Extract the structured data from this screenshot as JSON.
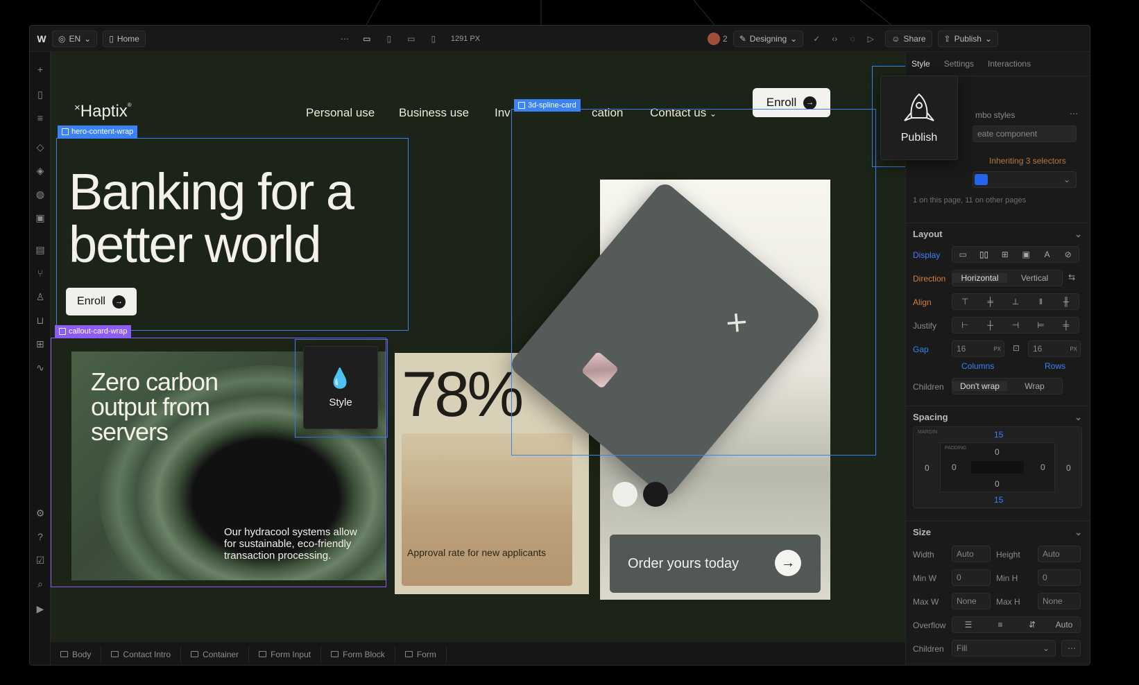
{
  "topbar": {
    "language": "EN",
    "page": "Home",
    "width_readout": "1291 PX",
    "collaborators_count": "2",
    "mode": "Designing",
    "share_label": "Share",
    "publish_label": "Publish"
  },
  "site": {
    "logo": "Haptix",
    "nav": [
      "Personal use",
      "Business use",
      "Inv",
      "cation",
      "Contact us"
    ],
    "enroll_label": "Enroll",
    "hero_title": "Banking for a better world",
    "hero_enroll_label": "Enroll",
    "card1_title": "Zero carbon output from servers",
    "card1_body": "Our hydracool systems allow for sustainable, eco-friendly transaction processing.",
    "card2_stat": "78%",
    "card2_label": "Approval rate for new applicants",
    "order_label": "Order yours today"
  },
  "selections": {
    "hero_tag": "hero-content-wrap",
    "callout_tag": "callout-card-wrap",
    "spline_tag": "3d-spline-card"
  },
  "popovers": {
    "style_label": "Style",
    "publish_label": "Publish"
  },
  "panel": {
    "tabs": [
      "Style",
      "Settings",
      "Interactions"
    ],
    "combo_styles": "mbo styles",
    "create_component": "eate component",
    "inheriting": "Inheriting 3 selectors",
    "page_usage": "1 on this page, 11 on other pages",
    "layout_title": "Layout",
    "display_label": "Display",
    "direction_label": "Direction",
    "direction_options": [
      "Horizontal",
      "Vertical"
    ],
    "align_label": "Align",
    "justify_label": "Justify",
    "gap_label": "Gap",
    "gap_columns": "16",
    "gap_rows": "16",
    "gap_unit": "PX",
    "columns_label": "Columns",
    "rows_label": "Rows",
    "children_label": "Children",
    "children_options": [
      "Don't wrap",
      "Wrap"
    ],
    "spacing_title": "Spacing",
    "margin_label": "MARGIN",
    "padding_label": "PADDING",
    "margin_top": "15",
    "margin_bottom": "15",
    "margin_left": "0",
    "margin_right": "0",
    "padding_top": "0",
    "padding_bottom": "0",
    "padding_left": "0",
    "padding_right": "0",
    "size_title": "Size",
    "width_label": "Width",
    "height_label": "Height",
    "width_value": "Auto",
    "height_value": "Auto",
    "minw_label": "Min W",
    "minh_label": "Min H",
    "minw_value": "0",
    "minh_value": "0",
    "maxw_label": "Max W",
    "maxh_label": "Max H",
    "maxw_value": "None",
    "maxh_value": "None",
    "overflow_label": "Overflow",
    "overflow_auto": "Auto",
    "children2_label": "Children",
    "children2_value": "Fill"
  },
  "breadcrumbs": [
    "Body",
    "Contact Intro",
    "Container",
    "Form Input",
    "Form Block",
    "Form"
  ],
  "colors": {
    "selection_blue": "#3b82f6",
    "selection_purple": "#8b5cf6",
    "canvas_bg": "#1b2416"
  }
}
